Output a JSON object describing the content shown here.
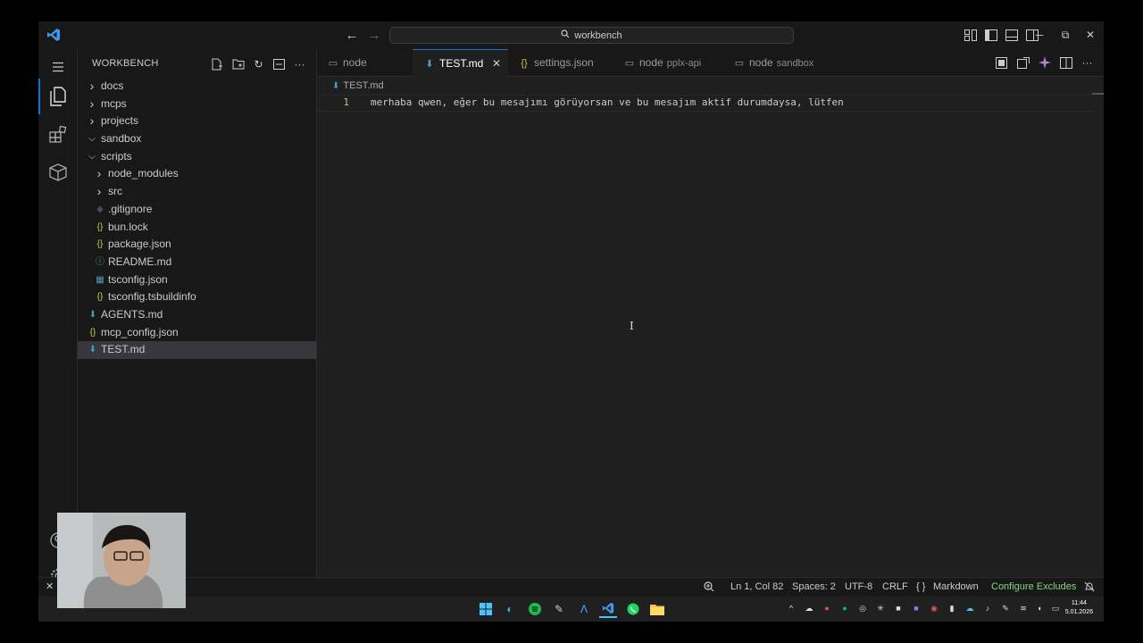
{
  "titlebar": {
    "search_text": "workbench"
  },
  "sidebar": {
    "header": "WORKBENCH",
    "items": [
      {
        "label": "docs",
        "kind": "folder",
        "expanded": false,
        "depth": 0
      },
      {
        "label": "mcps",
        "kind": "folder",
        "expanded": false,
        "depth": 0
      },
      {
        "label": "projects",
        "kind": "folder",
        "expanded": false,
        "depth": 0
      },
      {
        "label": "sandbox",
        "kind": "folder",
        "expanded": true,
        "depth": 0
      },
      {
        "label": "scripts",
        "kind": "folder",
        "expanded": true,
        "depth": 0
      },
      {
        "label": "node_modules",
        "kind": "folder",
        "expanded": false,
        "depth": 1
      },
      {
        "label": "src",
        "kind": "folder",
        "expanded": false,
        "depth": 1
      },
      {
        "label": ".gitignore",
        "kind": "gitignore",
        "depth": 1
      },
      {
        "label": "bun.lock",
        "kind": "json",
        "depth": 1
      },
      {
        "label": "package.json",
        "kind": "json",
        "depth": 1
      },
      {
        "label": "README.md",
        "kind": "info",
        "depth": 1
      },
      {
        "label": "tsconfig.json",
        "kind": "tsconfig",
        "depth": 1
      },
      {
        "label": "tsconfig.tsbuildinfo",
        "kind": "json",
        "depth": 1
      },
      {
        "label": "AGENTS.md",
        "kind": "markdown",
        "depth": 0
      },
      {
        "label": "mcp_config.json",
        "kind": "json",
        "depth": 0
      },
      {
        "label": "TEST.md",
        "kind": "markdown",
        "depth": 0,
        "selected": true
      }
    ]
  },
  "tabs": [
    {
      "label": "node",
      "desc": "",
      "icon": "terminal-icon"
    },
    {
      "label": "TEST.md",
      "desc": "",
      "icon": "markdown-icon",
      "active": true
    },
    {
      "label": "settings.json",
      "desc": "",
      "icon": "json-icon"
    },
    {
      "label": "node",
      "desc": "pplx-api",
      "icon": "terminal-icon"
    },
    {
      "label": "node",
      "desc": "sandbox",
      "icon": "terminal-icon"
    }
  ],
  "editor": {
    "breadcrumb": "TEST.md",
    "line_number": "1",
    "line_text": "merhaba qwen, eğer bu mesajımı görüyorsan ve bu mesajım aktif durumdaysa, lütfen"
  },
  "statusbar": {
    "position": "Ln 1, Col 82",
    "spaces": "Spaces: 2",
    "encoding": "UTF-8",
    "eol": "CRLF",
    "language_braces": "{ }",
    "language": "Markdown",
    "configure": "Configure Excludes"
  },
  "taskbar": {
    "time": "11:44",
    "date": "5.01.2026"
  },
  "colors": {
    "accent": "#0078d4",
    "markdown_icon": "#519aba",
    "json_icon": "#cbcb41",
    "status_green": "#89d185"
  }
}
